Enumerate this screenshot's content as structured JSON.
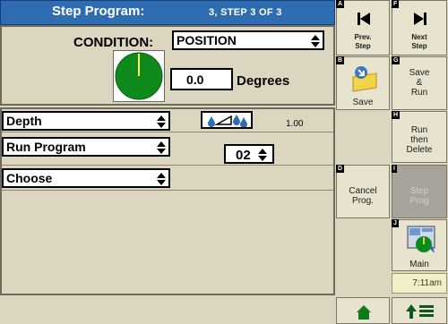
{
  "header": {
    "title": "Step Program:",
    "step_info": "3, STEP  3  OF  3"
  },
  "condition": {
    "label": "CONDITION:",
    "value": "POSITION",
    "degrees_value": "0.0",
    "degrees_label": "Degrees"
  },
  "rows": [
    {
      "select": "Depth",
      "icon": "water-depth-icon",
      "value": "1.00"
    },
    {
      "select": "Run Program",
      "number": "02"
    },
    {
      "select": "Choose"
    }
  ],
  "buttons": {
    "prev": {
      "key": "A",
      "label1": "Prev.",
      "label2": "Step"
    },
    "next": {
      "key": "F",
      "label1": "Next",
      "label2": "Step"
    },
    "save": {
      "key": "B",
      "label": "Save"
    },
    "save_run": {
      "key": "G",
      "label1": "Save",
      "label2": "&",
      "label3": "Run"
    },
    "run_delete": {
      "key": "H",
      "label1": "Run",
      "label2": "then",
      "label3": "Delete"
    },
    "cancel": {
      "key": "D",
      "label1": "Cancel",
      "label2": "Prog."
    },
    "step_prog": {
      "key": "I",
      "label1": "Step",
      "label2": "Prog"
    },
    "main": {
      "key": "J",
      "label": "Main"
    }
  },
  "clock": "7:11am",
  "colors": {
    "title_bar": "#2f6db3",
    "background": "#dcd6c0",
    "gauge": "#0e8a1c"
  }
}
